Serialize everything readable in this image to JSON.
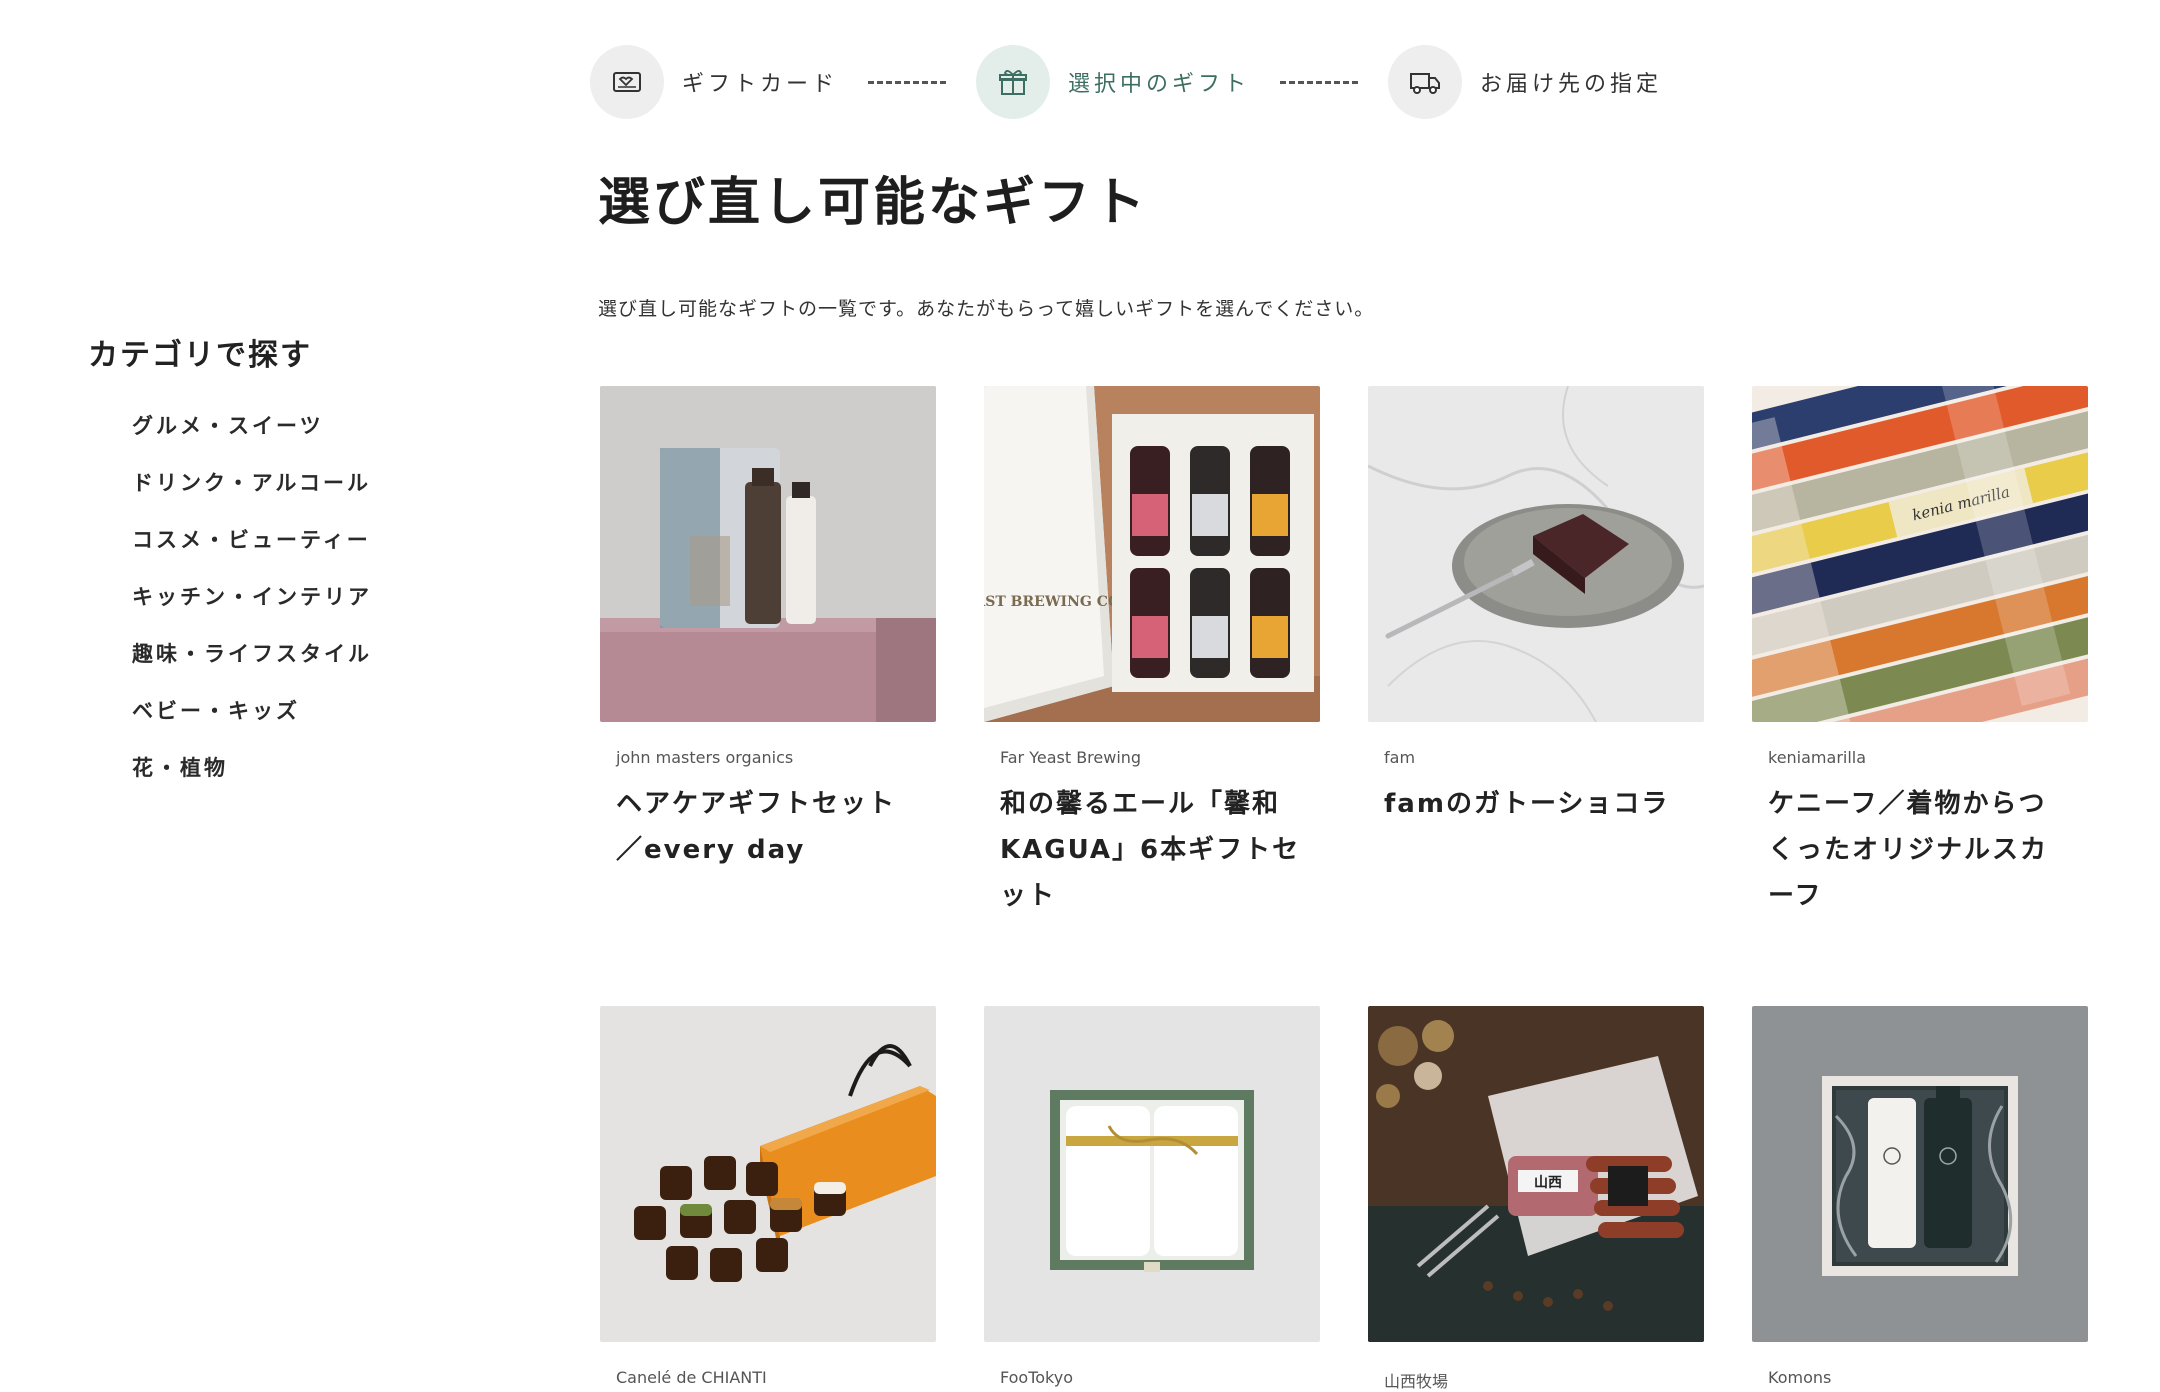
{
  "stepper": {
    "steps": [
      {
        "label": "ギフトカード",
        "icon": "gift-card-icon",
        "active": false
      },
      {
        "label": "選択中のギフト",
        "icon": "gift-box-icon",
        "active": true
      },
      {
        "label": "お届け先の指定",
        "icon": "delivery-truck-icon",
        "active": false
      }
    ]
  },
  "page": {
    "title": "選び直し可能なギフト",
    "description": "選び直し可能なギフトの一覧です。あなたがもらって嬉しいギフトを選んでください。"
  },
  "sidebar": {
    "title": "カテゴリで探す",
    "categories": [
      "グルメ・スイーツ",
      "ドリンク・アルコール",
      "コスメ・ビューティー",
      "キッチン・インテリア",
      "趣味・ライフスタイル",
      "ベビー・キッズ",
      "花・植物"
    ]
  },
  "products": [
    {
      "brand": "john masters organics",
      "name": "ヘアケアギフトセット／every day"
    },
    {
      "brand": "Far Yeast Brewing",
      "name": "和の馨るエール「馨和 KAGUA」6本ギフトセット"
    },
    {
      "brand": "fam",
      "name": "famのガトーショコラ"
    },
    {
      "brand": "keniamarilla",
      "name": "ケニーフ／着物からつくったオリジナルスカーフ"
    },
    {
      "brand": "Canelé de CHIANTI",
      "name": ""
    },
    {
      "brand": "FooTokyo",
      "name": ""
    },
    {
      "brand": "山西牧場",
      "name": ""
    },
    {
      "brand": "Komons",
      "name": ""
    }
  ],
  "images": {
    "box_label": "FAR YEAST BREWING COMPANY",
    "scarf_label": "kenia marilla",
    "meat_label": "山西"
  },
  "colors": {
    "accent": "#3d6e62",
    "step_active_bg": "#e3eeeb",
    "step_bg": "#eeeeee"
  }
}
